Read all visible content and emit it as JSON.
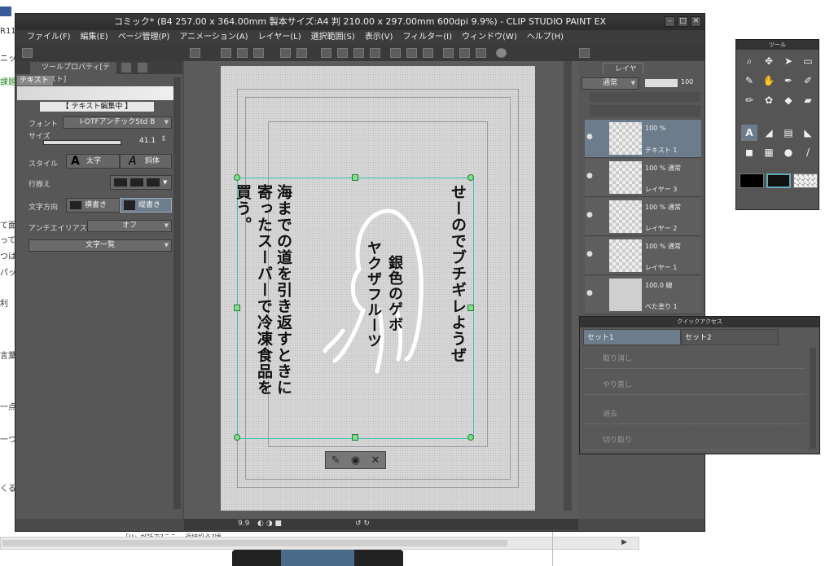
{
  "window": {
    "title": "コミック* (B4 257.00 x 364.00mm 製本サイズ:A4 判 210.00 x 297.00mm 600dpi 9.9%) - CLIP STUDIO PAINT EX"
  },
  "menu": [
    "ファイル(F)",
    "編集(E)",
    "ページ管理(P)",
    "アニメーション(A)",
    "レイヤー(L)",
    "選択範囲(S)",
    "表示(V)",
    "フィルター(I)",
    "ウィンドウ(W)",
    "ヘルプ(H)"
  ],
  "background": {
    "left_fragments": [
      "R11",
      "ニック",
      "課題",
      "て面",
      "って",
      "つは",
      "パッ",
      "利",
      "言葉",
      "一点",
      "一つ",
      "くる"
    ],
    "bottom_text": "「!!」が話で?ここ 、近接投う?頃 、…"
  },
  "tool_property": {
    "tab_label": "ツールプロパティ[テキスト]",
    "sub_tool": "テキスト 1",
    "editing_header": "【 テキスト編集中 】",
    "font_label": "フォント",
    "font_value": "I-OTFアンチックStd B",
    "size_label": "サイズ",
    "size_value": "41.1",
    "style_label": "スタイル",
    "bold_label": "太字",
    "italic_label": "斜体",
    "align_label": "行揃え",
    "direction_label": "文字方向",
    "horizontal_label": "横書き",
    "vertical_label": "縦書き",
    "antialias_label": "アンチエイリアス",
    "antialias_value": "オフ",
    "char_list_label": "文字一覧"
  },
  "canvas": {
    "col_right": "せーのでブチギレようぜ",
    "col_mid1": "銀色のゲボ",
    "col_mid2": "ヤクザフルーツ",
    "col_left1": "海までの道を引き返すときに",
    "col_left2": "寄ったスーパーで冷凍食品を",
    "col_left3": "買う。"
  },
  "status": {
    "zoom": "9.9"
  },
  "layer_panel": {
    "tab_label": "レイヤー",
    "blend_mode": "通常",
    "opacity": "100",
    "layers": [
      {
        "mode": "100 %",
        "name": "テキスト 1"
      },
      {
        "mode": "100 % 通常",
        "name": "レイヤー 3"
      },
      {
        "mode": "100 % 通常",
        "name": "レイヤー 2"
      },
      {
        "mode": "100 % 通常",
        "name": "レイヤー 1"
      },
      {
        "mode": "100.0 線",
        "name": "べた塗り 1"
      }
    ]
  },
  "tool_palette": {
    "title": "ツール"
  },
  "quick_access": {
    "title": "クイックアクセス",
    "tabs": [
      "セット1",
      "セット2"
    ],
    "items": [
      "取り消し",
      "やり直し",
      "消去",
      "切り取り"
    ]
  }
}
